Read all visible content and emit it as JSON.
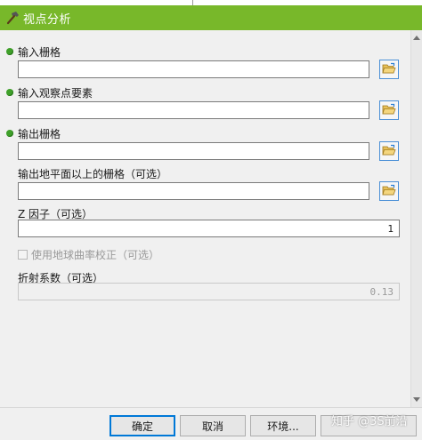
{
  "window": {
    "title": "视点分析",
    "title_icon": "hammer-icon",
    "titlebar_color": "#78b82a"
  },
  "params": [
    {
      "label": "输入栅格",
      "required": true,
      "value": "",
      "has_browse": true
    },
    {
      "label": "输入观察点要素",
      "required": true,
      "value": "",
      "has_browse": true
    },
    {
      "label": "输出栅格",
      "required": true,
      "value": "",
      "has_browse": true
    },
    {
      "label": "输出地平面以上的栅格（可选）",
      "required": false,
      "value": "",
      "has_browse": true
    },
    {
      "label": "Z 因子（可选）",
      "required": false,
      "value": "1",
      "has_browse": false
    }
  ],
  "checkbox": {
    "label": "使用地球曲率校正（可选）",
    "checked": false,
    "enabled": false
  },
  "refraction": {
    "label": "折射系数（可选）",
    "value": "0.13",
    "enabled": false
  },
  "buttons": {
    "ok": "确定",
    "cancel": "取消",
    "environments": "环境..."
  },
  "watermark": "知乎 @3S前沿",
  "icons": {
    "browse": "open-folder-icon",
    "required": "required-dot-icon"
  }
}
